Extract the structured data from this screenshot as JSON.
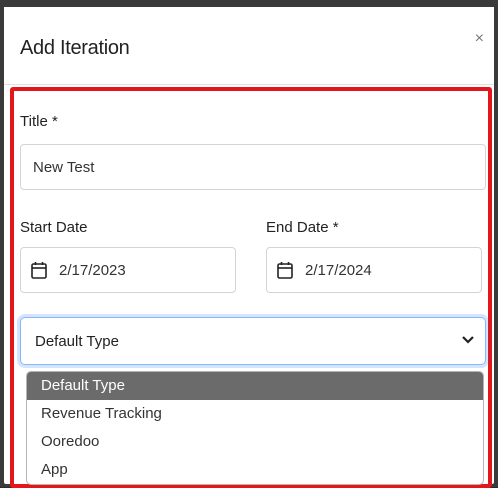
{
  "modal": {
    "title": "Add Iteration",
    "close_glyph": "×"
  },
  "form": {
    "title_label": "Title *",
    "title_value": "New Test",
    "start_label": "Start Date",
    "start_value": "2/17/2023",
    "end_label": "End Date *",
    "end_value": "2/17/2024",
    "type_selected": "Default Type",
    "type_options": [
      "Default Type",
      "Revenue Tracking",
      "Ooredoo",
      "App"
    ]
  },
  "colors": {
    "highlight": "#e3161c",
    "selected_option_bg": "#6b6b6b",
    "focus_border": "#86b7fe"
  }
}
